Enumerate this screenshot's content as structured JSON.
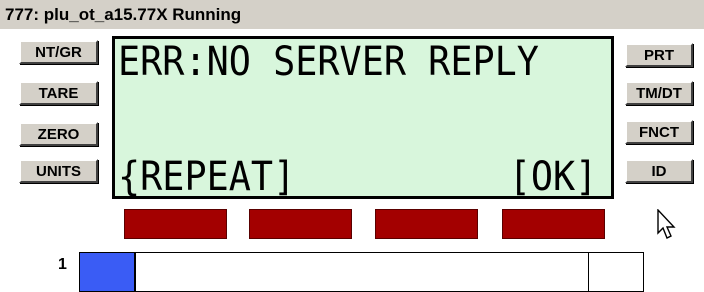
{
  "window": {
    "title": "777: plu_ot_a15.77X Running"
  },
  "left_buttons": [
    "NT/GR",
    "TARE",
    "ZERO",
    "UNITS"
  ],
  "right_buttons": [
    "PRT",
    "TM/DT",
    "FNCT",
    "ID"
  ],
  "display": {
    "line1": "ERR:NO SERVER REPLY",
    "softkey_left": "{REPEAT]",
    "softkey_right": "[OK]",
    "background_color": "#d8f6dc"
  },
  "indicators": {
    "count": 4,
    "color": "#a30000"
  },
  "channel": {
    "number": "1",
    "fill_color": "#3a5cf5",
    "progress_fraction": 0.1
  },
  "icons": {
    "pointer": "mouse-pointer-icon"
  }
}
